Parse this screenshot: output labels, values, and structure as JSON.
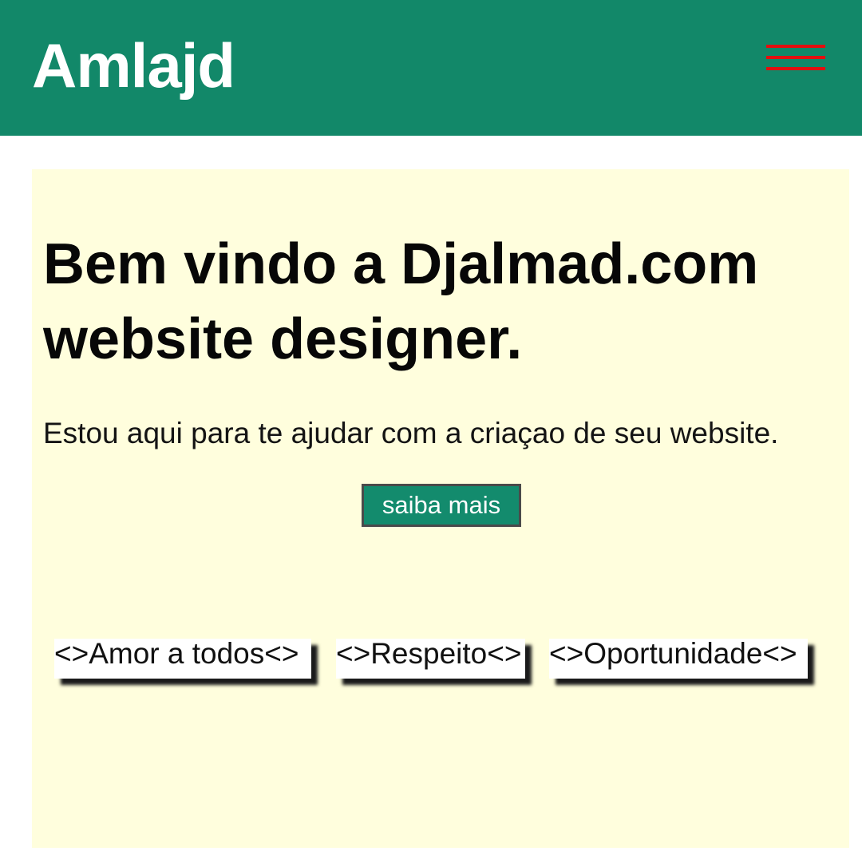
{
  "header": {
    "brand": "Amlajd",
    "background_color": "#128869",
    "menu_icon": "hamburger-menu-icon",
    "menu_icon_color": "#e30f0f"
  },
  "hero": {
    "background_color": "#fffedd",
    "headline": "Bem vindo a Djalmad.com website designer.",
    "tagline": "Estou aqui para te ajudar com a criaçao de seu website.",
    "cta_label": "saiba mais",
    "cta_color": "#138b6d"
  },
  "values": [
    {
      "label": "<>Amor a todos<>"
    },
    {
      "label": "<>Respeito<>"
    },
    {
      "label": "<>Oportunidade<>"
    }
  ]
}
